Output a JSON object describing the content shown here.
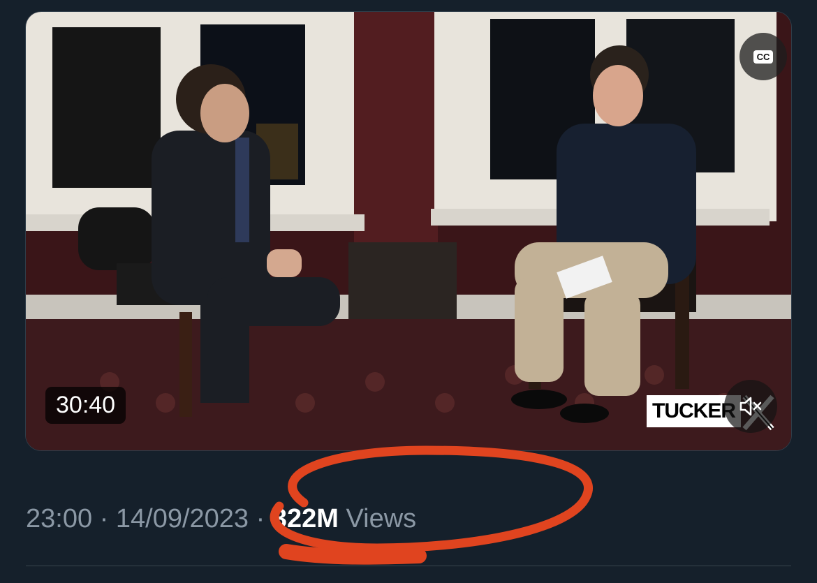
{
  "video": {
    "duration": "30:40",
    "cc_label": "CC",
    "logo_text": "TUCKER",
    "icons": {
      "captions": "cc-icon",
      "mute": "speaker-muted-icon"
    }
  },
  "tweet_meta": {
    "time": "23:00",
    "separator": "·",
    "date": "14/09/2023",
    "views_count": "322M",
    "views_label": "Views"
  },
  "colors": {
    "background": "#15202b",
    "meta_text": "#8b98a5",
    "annotation_red": "#e0441f"
  }
}
